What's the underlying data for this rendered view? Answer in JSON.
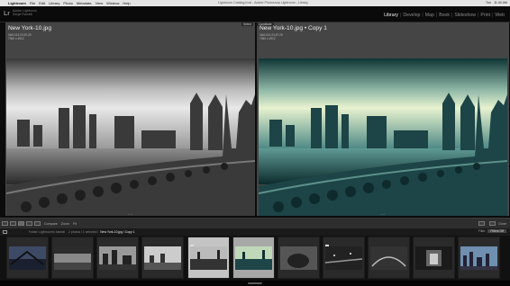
{
  "menubar": {
    "items": [
      "Lightroom",
      "File",
      "Edit",
      "Library",
      "Photo",
      "Metadata",
      "View",
      "Window",
      "Help"
    ],
    "window_title": "Lightroom Catalog.lrcat - Adobe Photoshop Lightroom - Library",
    "status": [
      "11:40 AM",
      "Tue"
    ]
  },
  "identity": {
    "logo": "Lr",
    "line1": "Adobe Lightroom",
    "line2": "Serge Ramelli"
  },
  "modules": [
    "Library",
    "Develop",
    "Map",
    "Book",
    "Slideshow",
    "Print",
    "Web"
  ],
  "active_module": "Library",
  "compare": {
    "left": {
      "tag": "Select",
      "title": "New York-10.jpg",
      "date": "06/01/15 23:57:29",
      "dims": "7360 x 4912"
    },
    "right": {
      "tag": "Candidate",
      "title": "New York-10.jpg  •  Copy 1",
      "date": "06/01/15 23:57:29",
      "dims": "7360 x 4912"
    },
    "dots": "• • •"
  },
  "toolbar": {
    "compare_label": "Compare",
    "zoom_label": "Zoom",
    "zoom_value": "Fit",
    "done_label": "Done"
  },
  "filmbar": {
    "path": "Folder: Lightroom's tutorial",
    "count": "2 photos / 1 selected /",
    "file": "New York-10.jpg / Copy 1",
    "filter_label": "Filter:",
    "filter_value": "Filters Off"
  },
  "colors": {
    "bg": "#0c0c0c",
    "pane": "#454545",
    "accent_teal": "#2f6a6a",
    "selection": "#c4c4c4"
  },
  "filmstrip": {
    "cells": [
      {
        "name": "city-bridge",
        "selected": false
      },
      {
        "name": "panorama",
        "selected": false
      },
      {
        "name": "skyline-day",
        "selected": false
      },
      {
        "name": "skyline-park",
        "selected": false
      },
      {
        "name": "new-york-10",
        "selected": true
      },
      {
        "name": "new-york-10-copy",
        "selected": true
      },
      {
        "name": "tunnel-arch",
        "selected": false
      },
      {
        "name": "bridge-night",
        "selected": false
      },
      {
        "name": "arch-bridge",
        "selected": false
      },
      {
        "name": "corridor",
        "selected": false
      },
      {
        "name": "city-panorama",
        "selected": false
      }
    ]
  }
}
